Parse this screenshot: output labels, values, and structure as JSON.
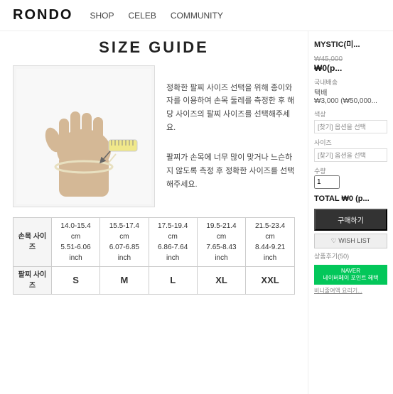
{
  "header": {
    "logo": "RONDO",
    "nav": [
      {
        "label": "SHOP",
        "href": "#"
      },
      {
        "label": "CELEB",
        "href": "#"
      },
      {
        "label": "COMMUNITY",
        "href": "#"
      }
    ]
  },
  "page": {
    "title": "SIZE GUIDE"
  },
  "guide": {
    "text1": "정확한 팔찌 사이즈 선택을 위해 종이와 자를 이용하여 손목 둘레를 측정한 후 해당 사이즈의 팔찌 사이즈를 선택해주세요.",
    "text2": "팔찌가 손목에 너무 많이 맞거나 느슨하지 않도록 측정 후 정확한 사이즈를 선택해주세요."
  },
  "size_table": {
    "col_header": "손목 사이즈",
    "col_header2": "팔찌 사이즈",
    "columns": [
      {
        "cm": "14.0-15.4",
        "inch": "5.51-6.06",
        "size": "S"
      },
      {
        "cm": "15.5-17.4",
        "inch": "6.07-6.85",
        "size": "M"
      },
      {
        "cm": "17.5-19.4",
        "inch": "6.86-7.64",
        "size": "L"
      },
      {
        "cm": "19.5-21.4",
        "inch": "7.65-8.43",
        "size": "XL"
      },
      {
        "cm": "21.5-23.4",
        "inch": "8.44-9.21",
        "size": "XXL"
      }
    ]
  },
  "sidebar": {
    "product_title": "MYSTIC(미...",
    "price_original": "₩45,000",
    "price": "₩0(p...",
    "delivery_label": "국내배송",
    "delivery_value": "택배",
    "delivery_fee": "₩3,000 (₩50,000...",
    "color_label": "색상",
    "color_option": "[찾기] 옵션을 선택",
    "size_label": "사이즈",
    "size_option": "[찾기] 옵션을 선택",
    "qty_label": "수량",
    "qty_value": "1",
    "total_label": "TOTAL",
    "total_value": "₩0 (p...",
    "buy_label": "구매하기",
    "wishlist_label": "♡ WISH LIST",
    "reviews_label": "상품후기(50)",
    "naver_pay_label": "NAVER\n네이버페이 포인트 혜택",
    "mini_link": "비니줄여액 요리기..."
  }
}
